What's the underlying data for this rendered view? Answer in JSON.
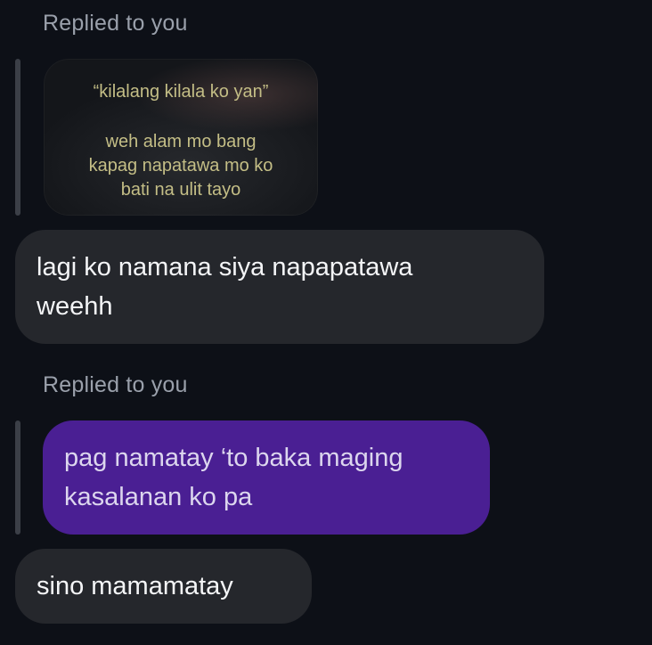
{
  "thread": {
    "reply_one": {
      "replied_label": "Replied to you",
      "story": {
        "quote": "“kilalang kilala ko yan”",
        "line1": "weh alam mo bang",
        "line2": "kapag napatawa mo ko",
        "line3": "bati na ulit tayo"
      },
      "message": {
        "line1": "lagi ko namana siya napapatawa",
        "line2": "weehh"
      }
    },
    "reply_two": {
      "replied_label": "Replied to you",
      "quoted_message": {
        "line1": "pag namatay ‘to baka maging",
        "line2": "kasalanan ko pa"
      },
      "message": "sino mamamatay"
    }
  },
  "colors": {
    "background": "#0d1017",
    "incoming_bubble": "#25272c",
    "own_bubble": "#4a1f93",
    "reply_bar": "#3b3f47",
    "label_text": "#9aa0ab",
    "story_text": "#c4be86"
  }
}
